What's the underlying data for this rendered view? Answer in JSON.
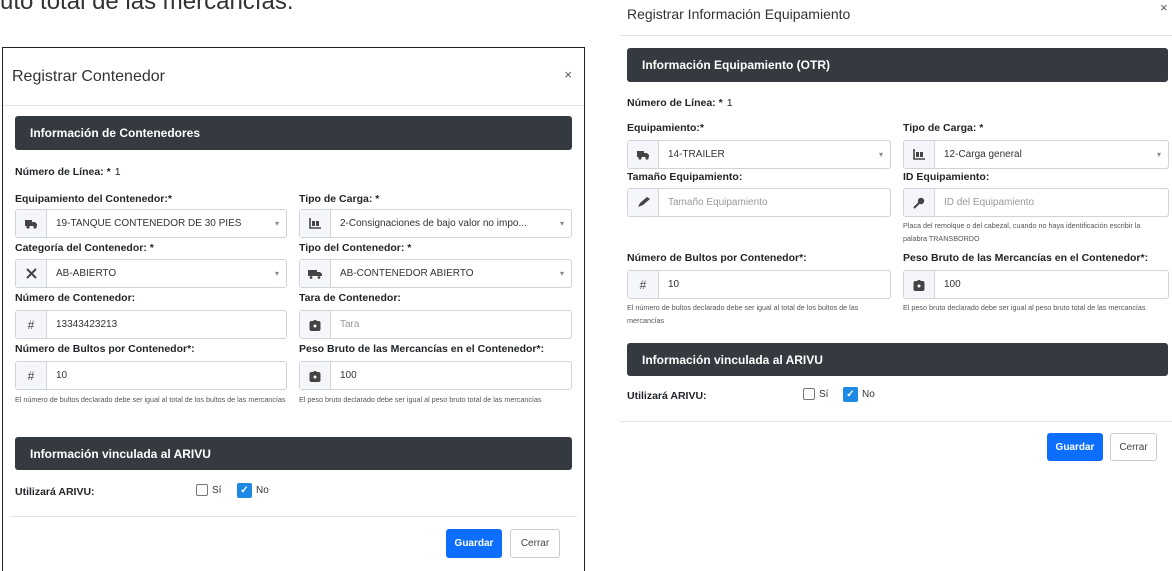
{
  "background_text": "uto total de las mercancías.",
  "modal1": {
    "title": "Registrar Contenedor",
    "close": "×",
    "section1": "Información de Contenedores",
    "line_label": "Número de Línea: *",
    "line_value": "1",
    "equip_label": "Equipamiento del Contenedor:*",
    "equip_value": "19-TANQUE CONTENEDOR DE 30 PIES",
    "cargo_label": "Tipo de Carga: *",
    "cargo_value": "2-Consignaciones de bajo valor no impo...",
    "category_label": "Categoría del Contenedor: *",
    "category_value": "AB-ABIERTO",
    "type_label": "Tipo del Contenedor: *",
    "type_value": "AB-CONTENEDOR ABIERTO",
    "number_label": "Número de Contenedor:",
    "number_value": "13343423213",
    "tara_label": "Tara de Contenedor:",
    "tara_placeholder": "Tara",
    "bultos_label": "Número de Bultos por Contenedor*:",
    "bultos_value": "10",
    "bultos_help": "El número de bultos declarado debe ser igual al total de los bultos de las mercancías",
    "peso_label": "Peso Bruto de las Mercancías en el Contenedor*:",
    "peso_value": "100",
    "peso_help": "El peso bruto declarado debe ser igual al peso bruto total de las mercancías",
    "section2": "Información vinculada al ARIVU",
    "arivu_label": "Utilizará ARIVU:",
    "si_label": "Sí",
    "no_label": "No",
    "save": "Guardar",
    "close_btn": "Cerrar"
  },
  "modal2": {
    "title": "Registrar Información Equipamiento",
    "close": "×",
    "section1": "Información Equipamiento (OTR)",
    "line_label": "Número de Línea: *",
    "line_value": "1",
    "equip_label": "Equipamiento:*",
    "equip_value": "14-TRAILER",
    "cargo_label": "Tipo de Carga: *",
    "cargo_value": "12-Carga general",
    "size_label": "Tamaño Equipamiento:",
    "size_placeholder": "Tamaño Equipamiento",
    "id_label": "ID Equipamiento:",
    "id_placeholder": "ID del Equipamiento",
    "id_help": "Placa del remolque o del cabezal, cuando no haya identificación escribir la palabra TRANSBORDO",
    "bultos_label": "Número de Bultos por Contenedor*:",
    "bultos_value": "10",
    "bultos_help": "El número de bultos declarado debe ser igual al total de los bultos de las mercancías",
    "peso_label": "Peso Bruto de las Mercancías en el Contenedor*:",
    "peso_value": "100",
    "peso_help": "El peso bruto declarado debe ser igual al peso bruto total de las mercancías",
    "section2": "Información vinculada al ARIVU",
    "arivu_label": "Utilizará ARIVU:",
    "si_label": "Sí",
    "no_label": "No",
    "save": "Guardar",
    "close_btn": "Cerrar"
  },
  "icons": {
    "hash": "#",
    "check": "✓",
    "caret": "▾"
  }
}
